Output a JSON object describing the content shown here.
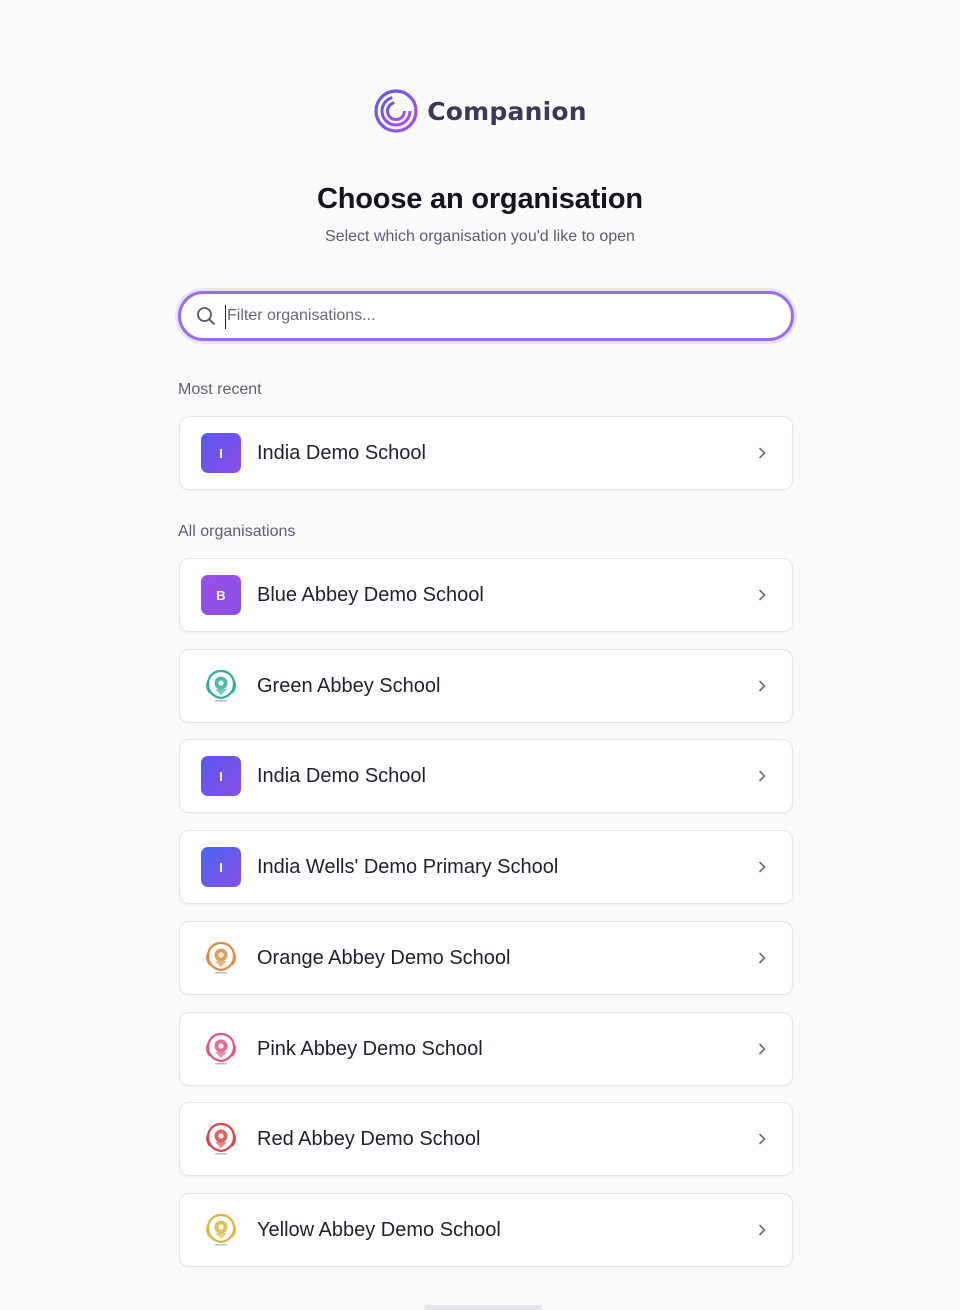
{
  "brand": {
    "name": "Companion",
    "accent": "#8b5cf6"
  },
  "header": {
    "title": "Choose an organisation",
    "subtitle": "Select which organisation you'd like to open"
  },
  "search": {
    "placeholder": "Filter organisations...",
    "value": "",
    "icon": "search-icon"
  },
  "sections": {
    "recent_label": "Most recent",
    "all_label": "All organisations"
  },
  "recent": [
    {
      "name": "India Demo School",
      "avatar_type": "initial",
      "initial": "I",
      "color": "#5a57f0"
    }
  ],
  "organisations": [
    {
      "name": "Blue Abbey Demo School",
      "avatar_type": "initial",
      "initial": "B",
      "color": "#9b4fe6"
    },
    {
      "name": "Green Abbey School",
      "avatar_type": "crest",
      "color": "#2fae9a"
    },
    {
      "name": "India Demo School",
      "avatar_type": "initial",
      "initial": "I",
      "color": "#5a57f0"
    },
    {
      "name": "India Wells' Demo Primary School",
      "avatar_type": "initial",
      "initial": "I",
      "color": "#4566f0"
    },
    {
      "name": "Orange Abbey Demo School",
      "avatar_type": "crest",
      "color": "#e08a3c"
    },
    {
      "name": "Pink Abbey Demo School",
      "avatar_type": "crest",
      "color": "#e0557f"
    },
    {
      "name": "Red Abbey Demo School",
      "avatar_type": "crest",
      "color": "#d94545"
    },
    {
      "name": "Yellow Abbey Demo School",
      "avatar_type": "crest",
      "color": "#d9b83a"
    }
  ]
}
